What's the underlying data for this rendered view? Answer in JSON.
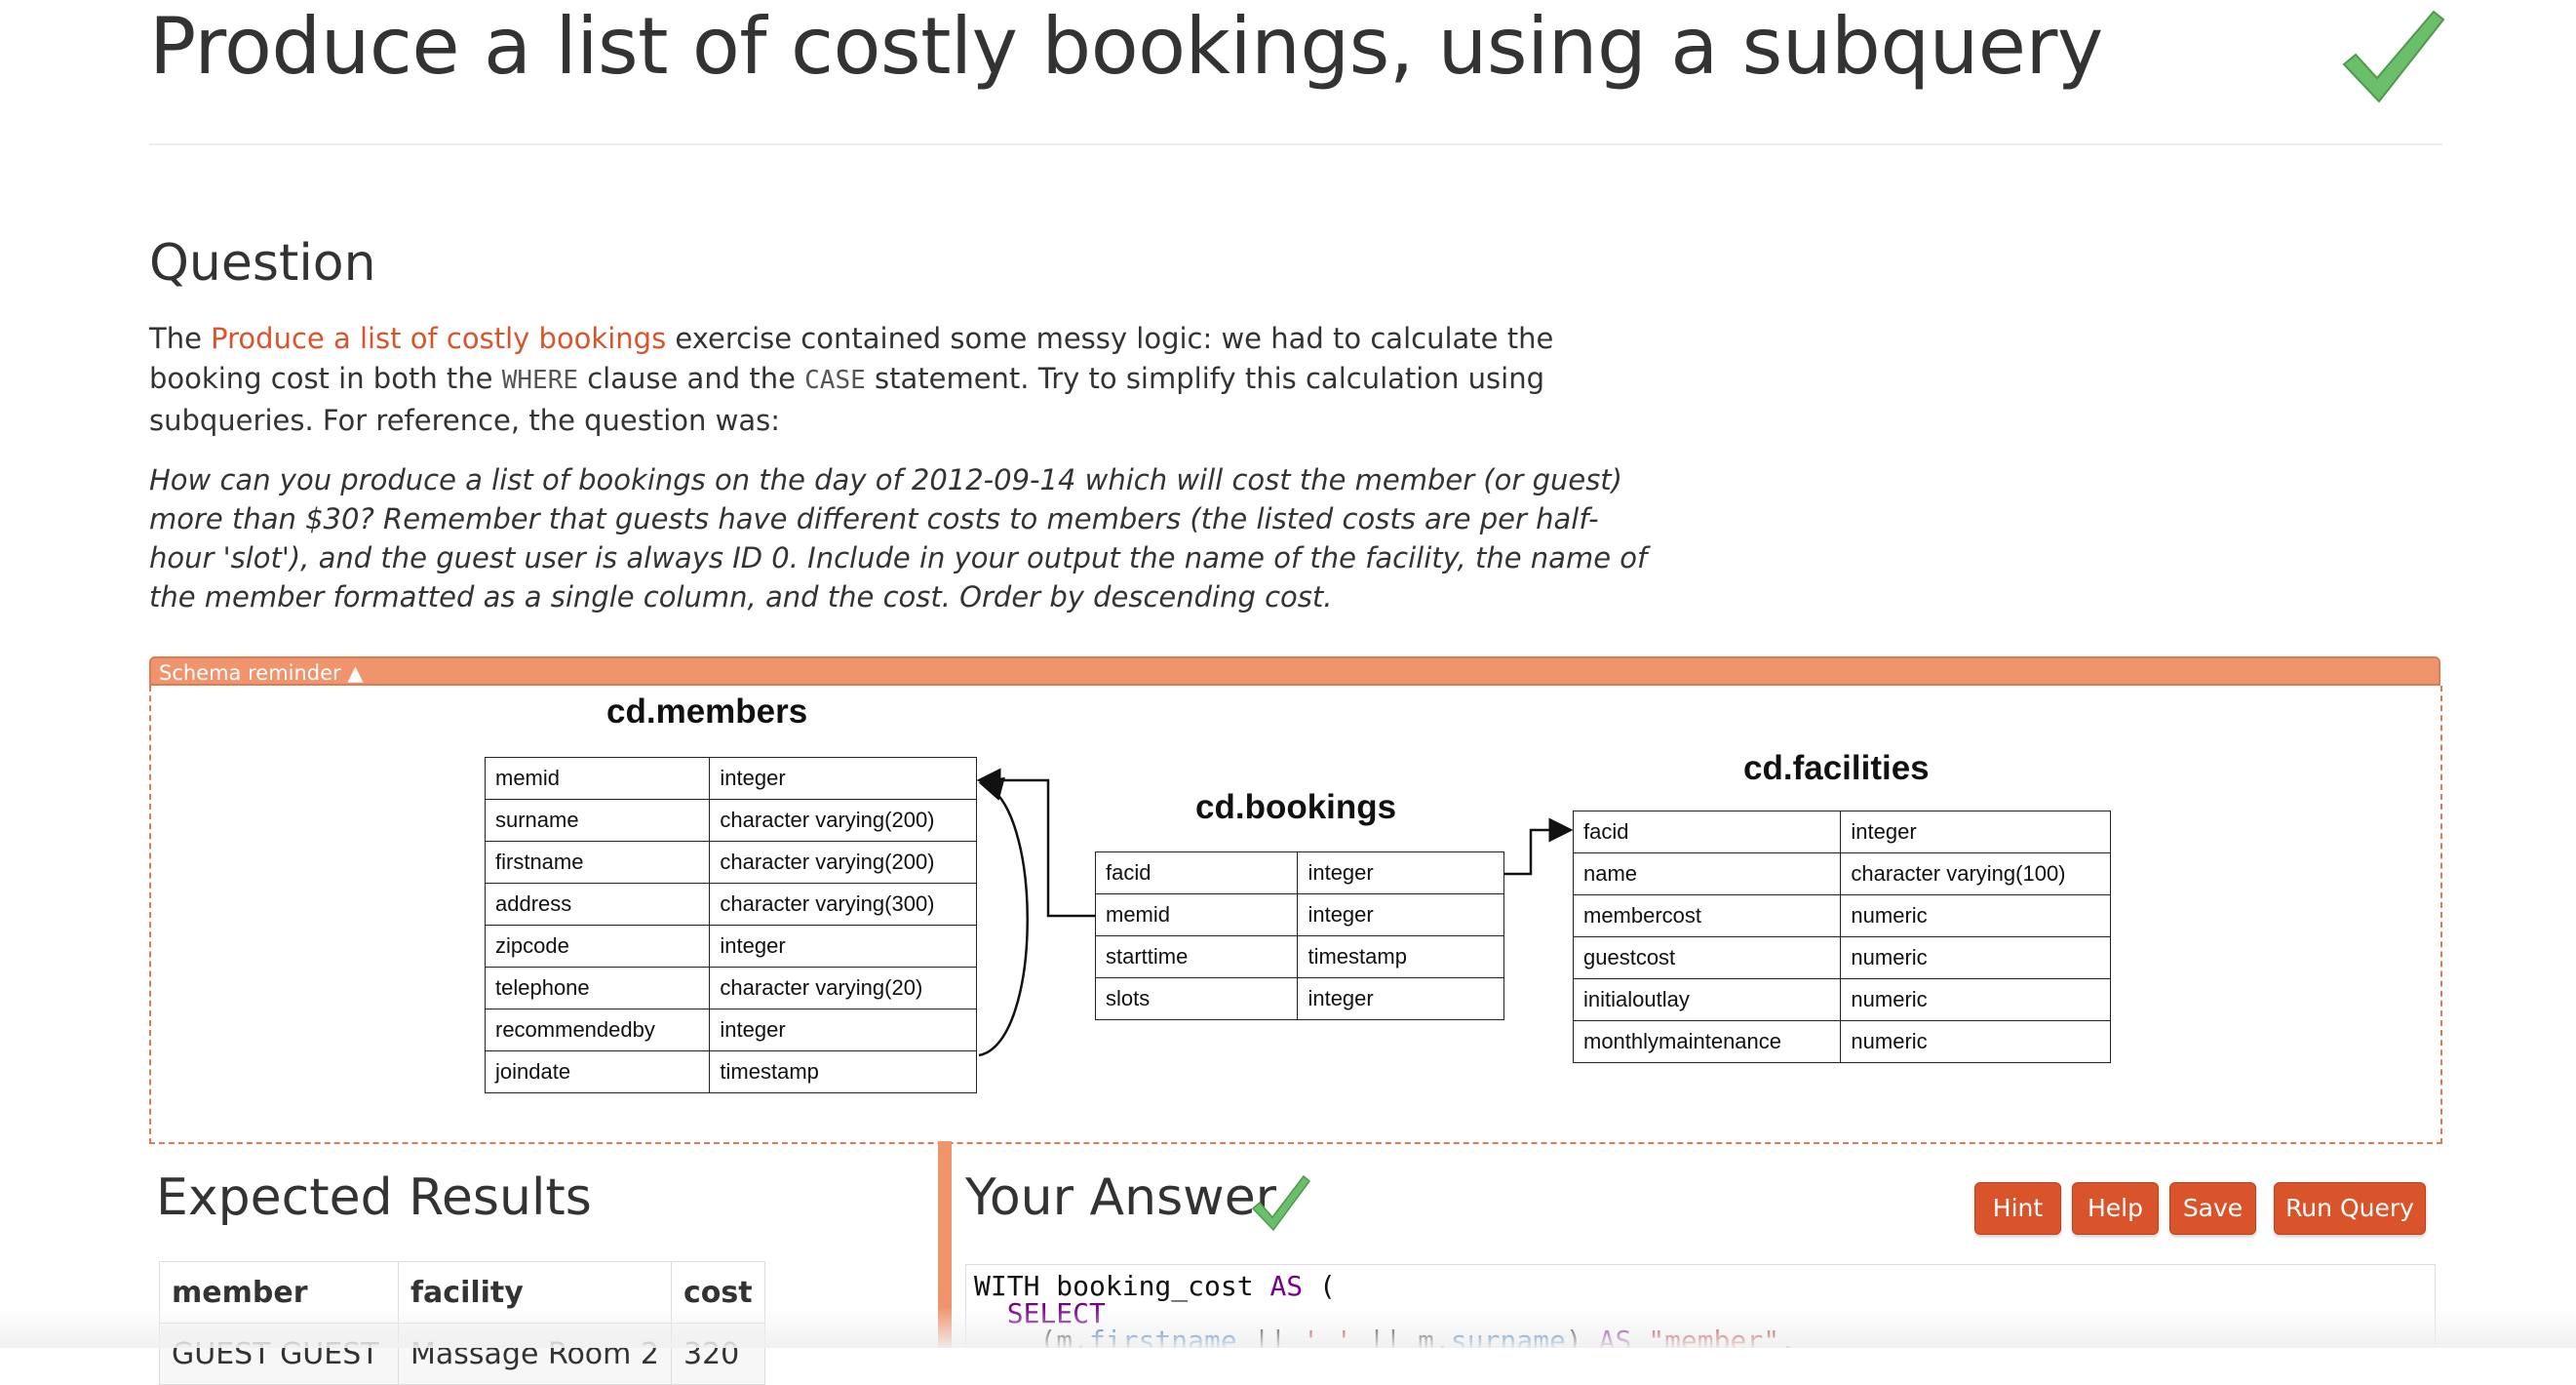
{
  "page": {
    "title": "Produce a list of costly bookings, using a subquery"
  },
  "question": {
    "heading": "Question",
    "intro_before_link": "The ",
    "intro_link": "Produce a list of costly bookings",
    "intro_after_link": " exercise contained some messy logic: we had to calculate the booking cost in both the ",
    "code_where": "WHERE",
    "intro_mid": " clause and the ",
    "code_case": "CASE",
    "intro_end": " statement. Try to simplify this calculation using subqueries. For reference, the question was:",
    "original_question": "How can you produce a list of bookings on the day of 2012-09-14 which will cost the member (or guest) more than $30? Remember that guests have different costs to members (the listed costs are per half-hour 'slot'), and the guest user is always ID 0. Include in your output the name of the facility, the name of the member formatted as a single column, and the cost. Order by descending cost."
  },
  "schema": {
    "toggle_label": "Schema reminder ▲",
    "members": {
      "title": "cd.members",
      "rows": [
        [
          "memid",
          "integer"
        ],
        [
          "surname",
          "character varying(200)"
        ],
        [
          "firstname",
          "character varying(200)"
        ],
        [
          "address",
          "character varying(300)"
        ],
        [
          "zipcode",
          "integer"
        ],
        [
          "telephone",
          "character varying(20)"
        ],
        [
          "recommendedby",
          "integer"
        ],
        [
          "joindate",
          "timestamp"
        ]
      ]
    },
    "bookings": {
      "title": "cd.bookings",
      "rows": [
        [
          "facid",
          "integer"
        ],
        [
          "memid",
          "integer"
        ],
        [
          "starttime",
          "timestamp"
        ],
        [
          "slots",
          "integer"
        ]
      ]
    },
    "facilities": {
      "title": "cd.facilities",
      "rows": [
        [
          "facid",
          "integer"
        ],
        [
          "name",
          "character varying(100)"
        ],
        [
          "membercost",
          "numeric"
        ],
        [
          "guestcost",
          "numeric"
        ],
        [
          "initialoutlay",
          "numeric"
        ],
        [
          "monthlymaintenance",
          "numeric"
        ]
      ]
    }
  },
  "expected": {
    "heading": "Expected Results",
    "columns": [
      "member",
      "facility",
      "cost"
    ],
    "rows": [
      [
        "GUEST GUEST",
        "Massage Room 2",
        "320"
      ]
    ]
  },
  "answer": {
    "heading": "Your Answer",
    "buttons": {
      "hint": "Hint",
      "help": "Help",
      "save": "Save",
      "run": "Run Query"
    },
    "code_lines": [
      [
        [
          "",
          "WITH booking_cost "
        ],
        [
          "kw",
          "AS"
        ],
        [
          "",
          " ("
        ]
      ],
      [
        [
          "",
          "  "
        ],
        [
          "kw",
          "SELECT"
        ]
      ],
      [
        [
          "",
          "    (m."
        ],
        [
          "prop",
          "firstname"
        ],
        [
          "",
          " || "
        ],
        [
          "str",
          "' '"
        ],
        [
          "",
          " || m."
        ],
        [
          "prop",
          "surname"
        ],
        [
          "",
          ") "
        ],
        [
          "kw",
          "AS"
        ],
        [
          "",
          " "
        ],
        [
          "str",
          "\"member\""
        ],
        [
          "",
          ","
        ]
      ]
    ]
  },
  "colors": {
    "accent": "#d9542b",
    "schema_bar": "#ef946d",
    "check_green": "#5cb85c"
  }
}
